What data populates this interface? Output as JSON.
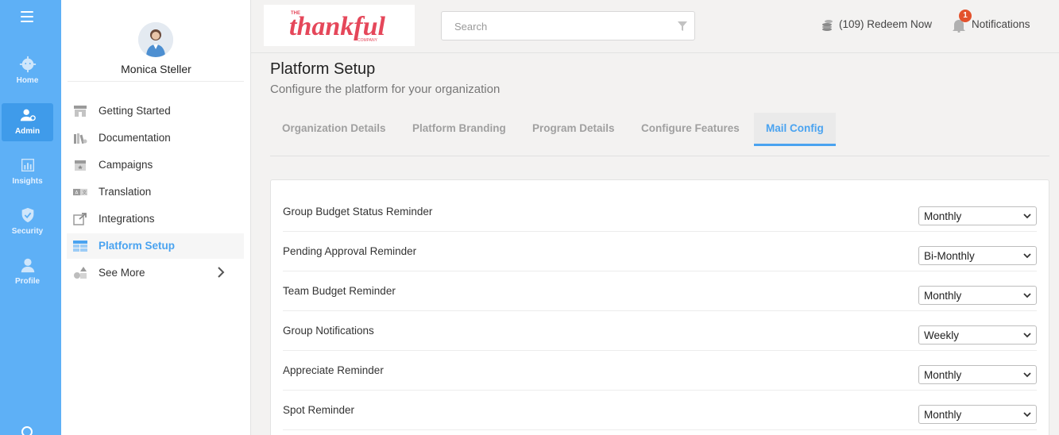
{
  "rail": {
    "items": [
      {
        "label": "Home",
        "icon": "cog-face-icon"
      },
      {
        "label": "Admin",
        "icon": "admin-user-icon"
      },
      {
        "label": "Insights",
        "icon": "bar-chart-icon"
      },
      {
        "label": "Security",
        "icon": "shield-icon"
      },
      {
        "label": "Profile",
        "icon": "person-icon"
      }
    ],
    "active": "Admin"
  },
  "sidebar": {
    "user_name": "Monica Steller",
    "items": [
      {
        "label": "Getting Started",
        "icon": "store-icon"
      },
      {
        "label": "Documentation",
        "icon": "books-icon"
      },
      {
        "label": "Campaigns",
        "icon": "calendar-star-icon"
      },
      {
        "label": "Translation",
        "icon": "translate-icon"
      },
      {
        "label": "Integrations",
        "icon": "external-link-icon"
      },
      {
        "label": "Platform Setup",
        "icon": "grid-table-icon"
      },
      {
        "label": "See More",
        "icon": "shapes-icon"
      }
    ],
    "active": "Platform Setup"
  },
  "header": {
    "logo_text": "thankful",
    "logo_small": "THE",
    "logo_company": "COMPANY",
    "search_placeholder": "Search",
    "redeem_text": "(109) Redeem Now",
    "notifications_label": "Notifications",
    "notifications_count": "1"
  },
  "page": {
    "title": "Platform Setup",
    "subtitle": "Configure the platform for your organization",
    "tabs": [
      {
        "label": "Organization Details"
      },
      {
        "label": "Platform Branding"
      },
      {
        "label": "Program Details"
      },
      {
        "label": "Configure Features"
      },
      {
        "label": "Mail Config"
      }
    ],
    "active_tab": "Mail Config"
  },
  "mail_config": {
    "rows": [
      {
        "label": "Group Budget Status Reminder",
        "value": "Monthly"
      },
      {
        "label": "Pending Approval Reminder",
        "value": "Bi-Monthly"
      },
      {
        "label": "Team Budget Reminder",
        "value": "Monthly"
      },
      {
        "label": "Group Notifications",
        "value": "Weekly"
      },
      {
        "label": "Appreciate Reminder",
        "value": "Monthly"
      },
      {
        "label": "Spot Reminder",
        "value": "Monthly"
      }
    ]
  },
  "colors": {
    "rail": "#5eb0f6",
    "accent": "#4aa3f0",
    "logo": "#e5475a",
    "badge": "#e3522d"
  }
}
